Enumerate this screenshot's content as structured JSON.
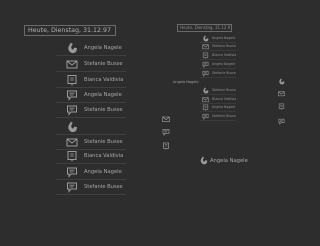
{
  "header": {
    "date_text": "Heute, Dienstag, 31.12.97",
    "small_date_text": "Heute, Dienstag, 31.12.97"
  },
  "left_list": [
    {
      "icon": "phone-icon",
      "label": "Angela Nagele"
    },
    {
      "icon": "mail-icon",
      "label": "Stefanie Busse"
    },
    {
      "icon": "note-icon",
      "label": "Bianca Valdivia"
    },
    {
      "icon": "chat-icon",
      "label": "Angela Nagele"
    },
    {
      "icon": "chat-icon",
      "label": "Stefanie Busse"
    },
    {
      "icon": "phone-icon",
      "label": ""
    },
    {
      "icon": "mail-icon",
      "label": "Stefanie Busse"
    },
    {
      "icon": "note-icon",
      "label": "Bianca Valdivia"
    },
    {
      "icon": "chat-icon",
      "label": "Angela Nagele"
    },
    {
      "icon": "chat-icon",
      "label": "Stefanie Busse"
    }
  ],
  "small_list": [
    {
      "icon": "phone-icon",
      "label": "Angela Nagele"
    },
    {
      "icon": "mail-icon",
      "label": "Stefanie Busse"
    },
    {
      "icon": "note-icon",
      "label": "Bianca Valdivia"
    },
    {
      "icon": "chat-icon",
      "label": "Angela Nagele"
    },
    {
      "icon": "chat-icon",
      "label": "Stefanie Busse"
    },
    {
      "icon": "phone-icon",
      "label": "Stefanie Busse"
    },
    {
      "icon": "mail-icon",
      "label": "Bianca Valdivia"
    },
    {
      "icon": "note-icon",
      "label": "Angela Nagele"
    },
    {
      "icon": "chat-icon",
      "label": "Stefanie Busse"
    }
  ],
  "side_label": "Angela Nagele",
  "bottom_contact": "Angela Nagele",
  "colors": {
    "background": "#2d2d2d",
    "text": "#a8a8a8",
    "icon": "#9a9a9a"
  }
}
